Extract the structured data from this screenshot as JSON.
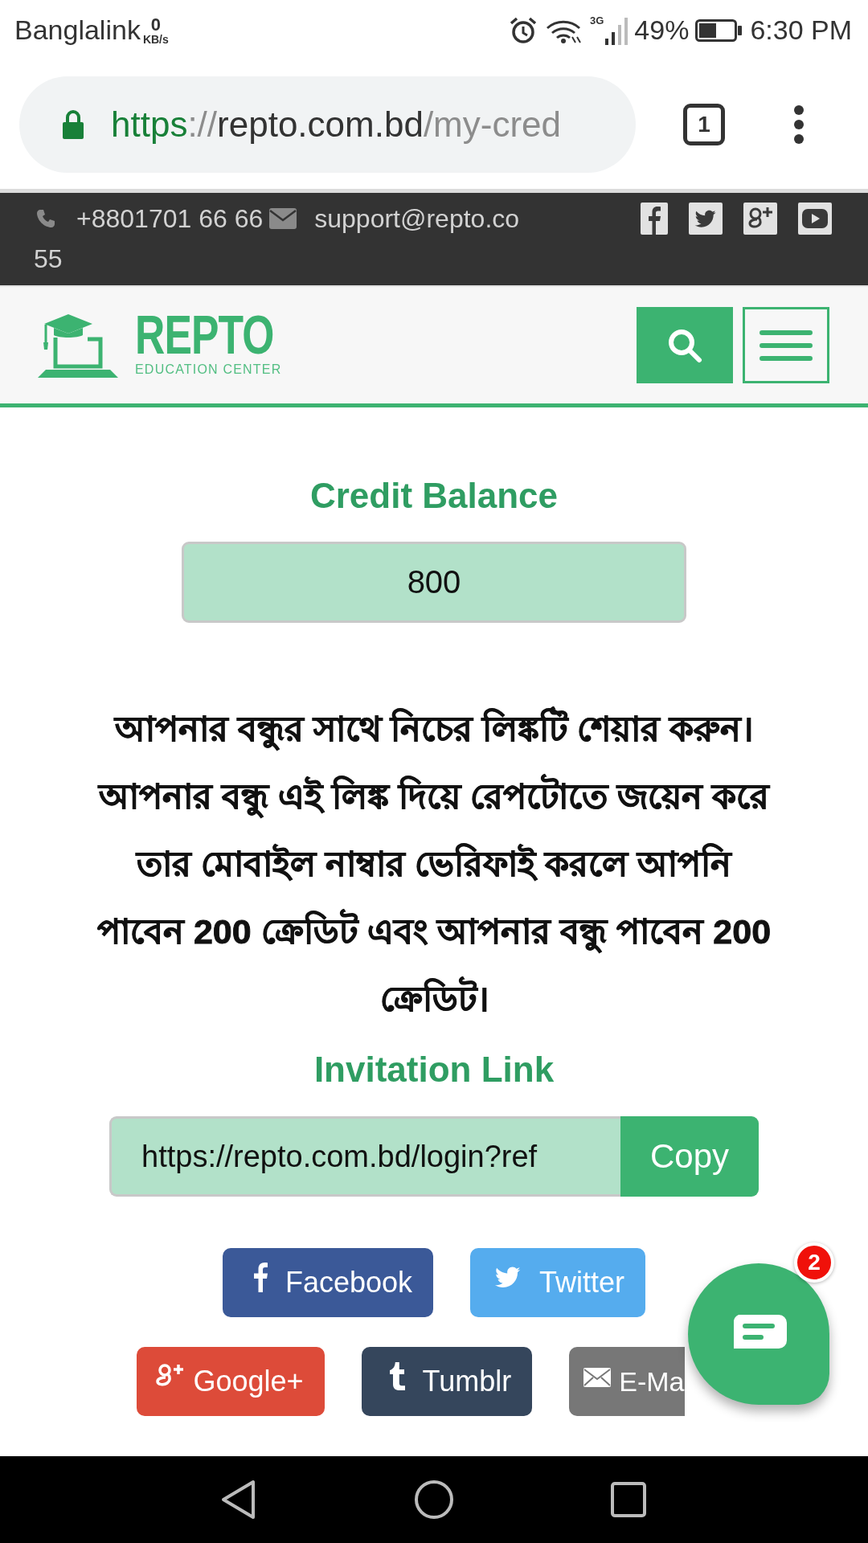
{
  "status_bar": {
    "carrier": "Banglalink",
    "speed_value": "0",
    "speed_unit": "KB/s",
    "network": "3G",
    "battery": "49%",
    "time": "6:30 PM"
  },
  "browser": {
    "url_scheme": "https",
    "url_separator": "://",
    "url_host": "repto.com.bd",
    "url_path": "/my-cred",
    "tab_count": "1"
  },
  "top_bar": {
    "phone_parts": [
      "+8801701 66 66",
      "55"
    ],
    "email": "support@repto.co"
  },
  "header": {
    "logo_title": "REPTO",
    "logo_subtitle": "EDUCATION CENTER"
  },
  "credit": {
    "title": "Credit Balance",
    "value": "800"
  },
  "message_lines": [
    "আপনার বন্ধুর সাথে নিচের লিঙ্কটি শেয়ার করুন।",
    "আপনার বন্ধু এই লিঙ্ক দিয়ে রেপটোতে জয়েন করে",
    "তার মোবাইল নাম্বার ভেরিফাই করলে আপনি",
    "পাবেন 200 ক্রেডিট এবং আপনার বন্ধু পাবেন 200",
    "ক্রেডিট।"
  ],
  "invitation": {
    "title": "Invitation Link",
    "link": "https://repto.com.bd/login?ref",
    "copy_label": "Copy"
  },
  "share_buttons": [
    {
      "kind": "facebook",
      "label": "Facebook",
      "color": "#3b5998"
    },
    {
      "kind": "twitter",
      "label": "Twitter",
      "color": "#55acee"
    },
    {
      "kind": "googleplus",
      "label": "Google+",
      "color": "#dd4b39"
    },
    {
      "kind": "tumblr",
      "label": "Tumblr",
      "color": "#35465c"
    },
    {
      "kind": "email",
      "label": "E-Ma",
      "color": "#777777"
    }
  ],
  "chat": {
    "badge": "2"
  }
}
